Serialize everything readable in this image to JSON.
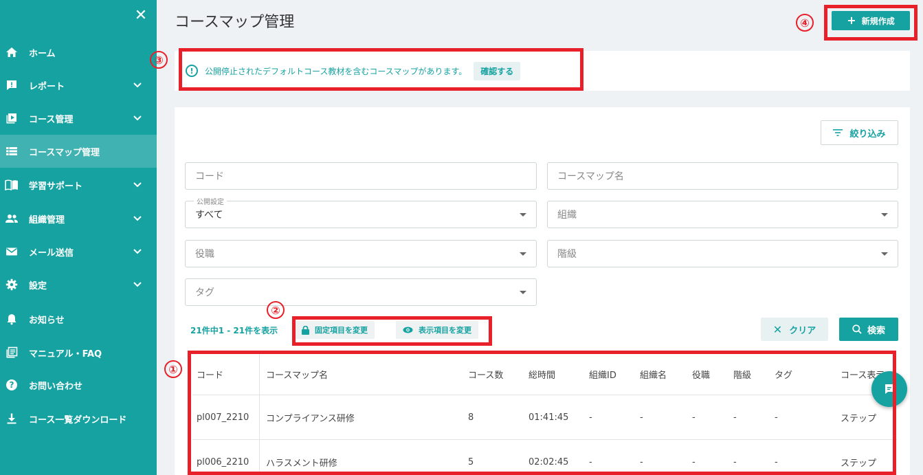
{
  "sidebar": {
    "items": [
      {
        "label": "ホーム",
        "icon": "home-icon",
        "chevron": false,
        "active": false
      },
      {
        "label": "レポート",
        "icon": "report-icon",
        "chevron": true,
        "active": false
      },
      {
        "label": "コース管理",
        "icon": "course-icon",
        "chevron": true,
        "active": false
      },
      {
        "label": "コースマップ管理",
        "icon": "list-icon",
        "chevron": false,
        "active": true
      },
      {
        "label": "学習サポート",
        "icon": "book-icon",
        "chevron": true,
        "active": false
      },
      {
        "label": "組織管理",
        "icon": "people-icon",
        "chevron": true,
        "active": false
      },
      {
        "label": "メール送信",
        "icon": "mail-icon",
        "chevron": true,
        "active": false
      },
      {
        "label": "設定",
        "icon": "gear-icon",
        "chevron": true,
        "active": false
      },
      {
        "label": "お知らせ",
        "icon": "bell-icon",
        "chevron": false,
        "active": false
      },
      {
        "label": "マニュアル・FAQ",
        "icon": "manual-icon",
        "chevron": false,
        "active": false
      },
      {
        "label": "お問い合わせ",
        "icon": "help-icon",
        "chevron": false,
        "active": false
      },
      {
        "label": "コース一覧ダウンロード",
        "icon": "download-icon",
        "chevron": false,
        "active": false
      }
    ]
  },
  "header": {
    "title": "コースマップ管理",
    "new_label": "新規作成"
  },
  "annotations": {
    "n1": "①",
    "n2": "②",
    "n3": "③",
    "n4": "④"
  },
  "alert": {
    "text": "公開停止されたデフォルトコース教材を含むコースマップがあります。",
    "confirm_label": "確認する"
  },
  "filter": {
    "button_label": "絞り込み",
    "code_placeholder": "コード",
    "name_placeholder": "コースマップ名",
    "publish_legend": "公開設定",
    "publish_value": "すべて",
    "org_placeholder": "組織",
    "role_placeholder": "役職",
    "rank_placeholder": "階級",
    "tag_placeholder": "タグ"
  },
  "results": {
    "count_text": "21件中1 - 21件を表示",
    "fixed_label": "固定項目を変更",
    "display_label": "表示項目を変更",
    "clear_label": "クリア",
    "search_label": "検索"
  },
  "table": {
    "headers": [
      "コード",
      "コースマップ名",
      "コース数",
      "総時間",
      "組織ID",
      "組織名",
      "役職",
      "階級",
      "タグ",
      "コース表示"
    ],
    "rows": [
      [
        "pl007_2210",
        "コンプライアンス研修",
        "8",
        "01:41:45",
        "-",
        "-",
        "-",
        "-",
        "-",
        "ステップ"
      ],
      [
        "pl006_2210",
        "ハラスメント研修",
        "5",
        "02:02:45",
        "-",
        "-",
        "-",
        "-",
        "-",
        "ステップ"
      ]
    ]
  },
  "colors": {
    "accent": "#17a2a2",
    "annotation": "#e8202a",
    "background": "#eef2f4"
  }
}
